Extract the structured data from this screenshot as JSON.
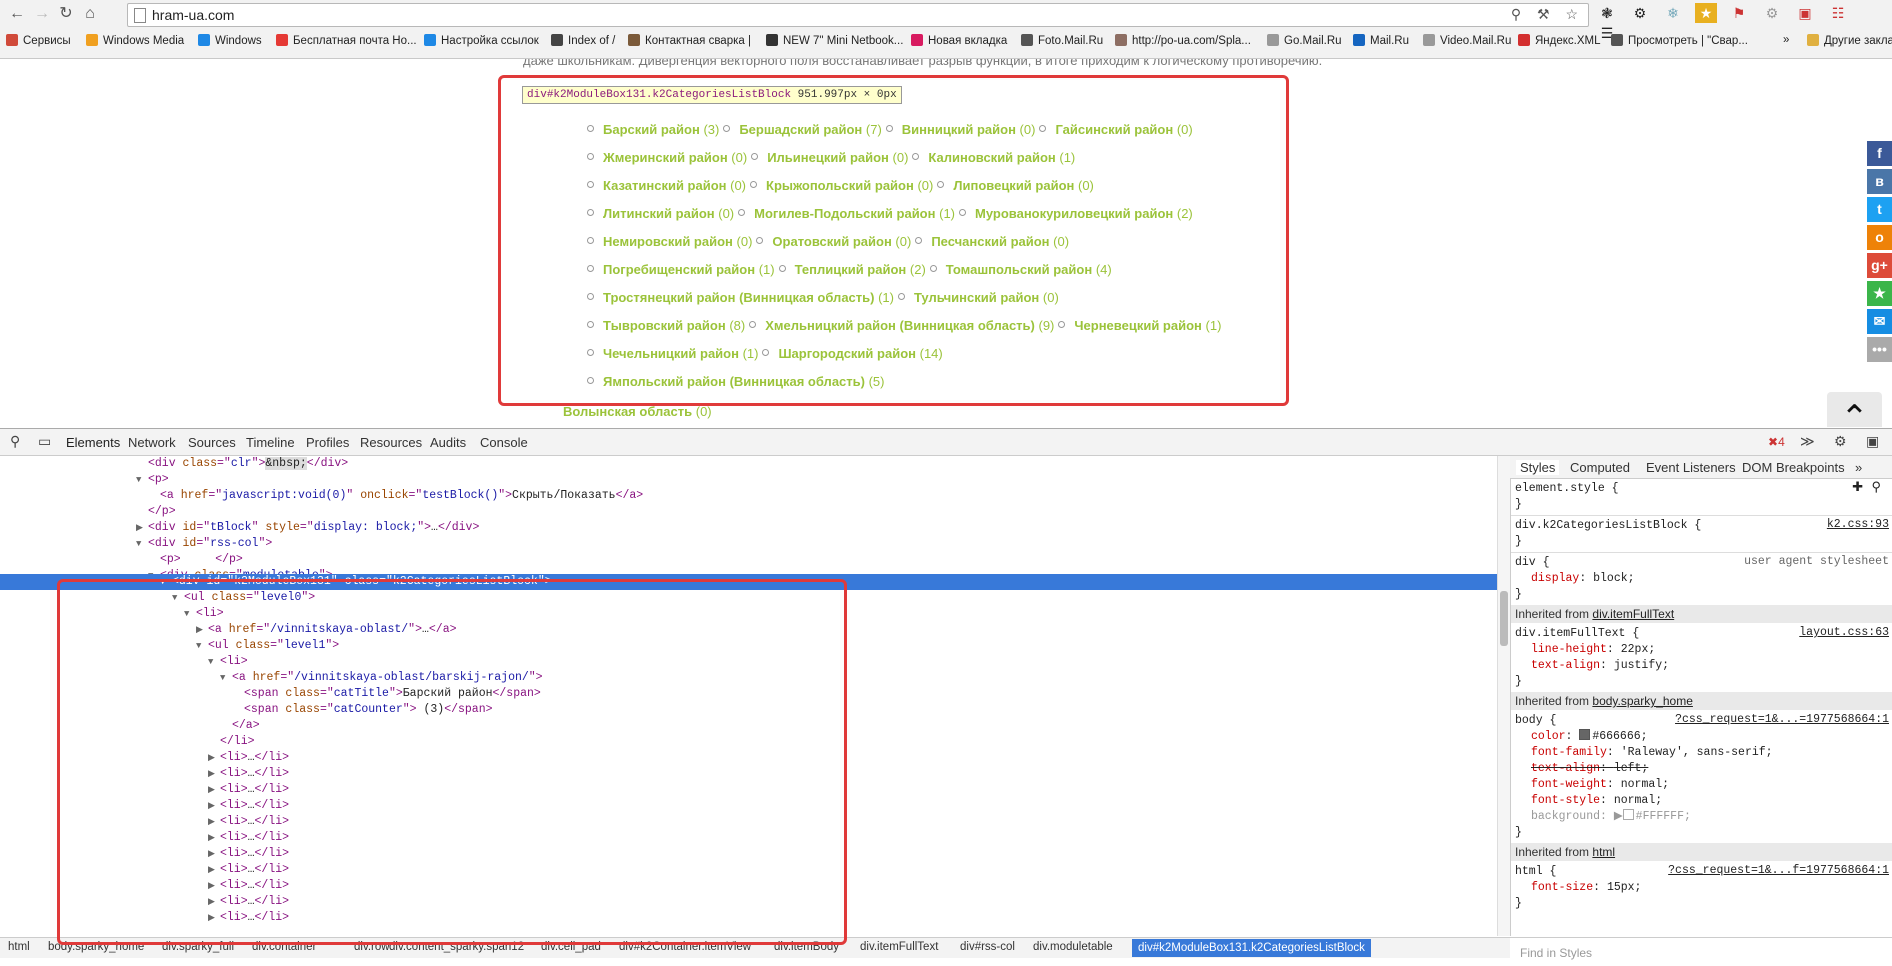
{
  "browser": {
    "url": "hram-ua.com",
    "bookmarks": [
      {
        "label": "Сервисы",
        "color": "#d04a3a"
      },
      {
        "label": "Windows Media",
        "color": "#f0a020"
      },
      {
        "label": "Windows",
        "color": "#1e88e5"
      },
      {
        "label": "Бесплатная почта Но...",
        "color": "#e53935"
      },
      {
        "label": "Настройка ссылок",
        "color": "#1e88e5"
      },
      {
        "label": "Index of /",
        "color": "#444444"
      },
      {
        "label": "Контактная сварка |",
        "color": "#7b5a3a"
      },
      {
        "label": "NEW 7\" Mini Netbook...",
        "color": "#333333"
      },
      {
        "label": "Новая вкладка",
        "color": "#d81b60"
      },
      {
        "label": "Foto.Mail.Ru",
        "color": "#555555"
      },
      {
        "label": "http://po-ua.com/Spla...",
        "color": "#8d6e63"
      },
      {
        "label": "Go.Mail.Ru",
        "color": "#999999"
      },
      {
        "label": "Mail.Ru",
        "color": "#1565c0"
      },
      {
        "label": "Video.Mail.Ru",
        "color": "#999999"
      },
      {
        "label": "Яндекс.XML",
        "color": "#d32f2f"
      },
      {
        "label": "Просмотреть | \"Свар...",
        "color": "#555555"
      },
      {
        "label": "Другие закладки",
        "color": "#e0b040"
      }
    ]
  },
  "page": {
    "top_text": "даже школьникам. Дивергенция векторного поля восстанавливает разрыв функции, в итоге приходим к логическому противоречию.",
    "tooltip": {
      "tag": "div",
      "id_cls": "#k2ModuleBox131.k2CategoriesListBlock",
      "size": "951.997px × 0px"
    },
    "categories": [
      [
        [
          "Барский район",
          "(3)"
        ],
        [
          "Бершадский район",
          "(7)"
        ],
        [
          "Винницкий район",
          "(0)"
        ],
        [
          "Гайсинский район",
          "(0)"
        ]
      ],
      [
        [
          "Жмеринский район",
          "(0)"
        ],
        [
          "Ильинецкий район",
          "(0)"
        ],
        [
          "Калиновский район",
          "(1)"
        ]
      ],
      [
        [
          "Казатинский район",
          "(0)"
        ],
        [
          "Крыжопольский район",
          "(0)"
        ],
        [
          "Липовецкий район",
          "(0)"
        ]
      ],
      [
        [
          "Литинский район",
          "(0)"
        ],
        [
          "Могилев-Подольский район",
          "(1)"
        ],
        [
          "Мурованокуриловецкий район",
          "(2)"
        ]
      ],
      [
        [
          "Немировский район",
          "(0)"
        ],
        [
          "Оратовский район",
          "(0)"
        ],
        [
          "Песчанский район",
          "(0)"
        ]
      ],
      [
        [
          "Погребищенский район",
          "(1)"
        ],
        [
          "Теплицкий район",
          "(2)"
        ],
        [
          "Томашпольский район",
          "(4)"
        ]
      ],
      [
        [
          "Тростянецкий район (Винницкая область)",
          "(1)"
        ],
        [
          "Тульчинский район",
          "(0)"
        ]
      ],
      [
        [
          "Тывровский район",
          "(8)"
        ],
        [
          "Хмельницкий район (Винницкая область)",
          "(9)"
        ],
        [
          "Черневецкий район",
          "(1)"
        ]
      ],
      [
        [
          "Чечельницкий район",
          "(1)"
        ],
        [
          "Шаргородский район",
          "(14)"
        ]
      ],
      [
        [
          "Ямпольский район (Винницкая область)",
          "(5)"
        ]
      ]
    ],
    "oblast": "Волынская область",
    "oblast_count": "(0)",
    "share": [
      {
        "label": "f",
        "color": "#3b5998"
      },
      {
        "label": "в",
        "color": "#4a76a8"
      },
      {
        "label": "t",
        "color": "#1da1f2"
      },
      {
        "label": "о",
        "color": "#ee8208"
      },
      {
        "label": "g+",
        "color": "#dd4b39"
      },
      {
        "label": "★",
        "color": "#3bb54a"
      },
      {
        "label": "✉",
        "color": "#168de2"
      },
      {
        "label": "•••",
        "color": "#aaaaaa"
      }
    ]
  },
  "devtools": {
    "tabs": [
      "Elements",
      "Network",
      "Sources",
      "Timeline",
      "Profiles",
      "Resources",
      "Audits",
      "Console"
    ],
    "error_count": "4",
    "style_tabs": [
      "Styles",
      "Computed",
      "Event Listeners",
      "DOM Breakpoints",
      "»"
    ],
    "crumbs": [
      "html",
      "body.sparky_home",
      "div.sparky_full",
      "div.container",
      "div.row",
      "div.content_sparky.span12",
      "div.cell_pad",
      "div#k2Container.itemView",
      "div.itemBody",
      "div.itemFullText",
      "div#rss-col",
      "div.moduletable",
      "div#k2ModuleBox131.k2CategoriesListBlock"
    ],
    "find_placeholder": "Find in Styles",
    "styles": {
      "element_style": "element.style {",
      "rule1": "div.k2CategoriesListBlock {",
      "rule1_src": "k2.css:93",
      "rule2": "div {",
      "rule2_src": "user agent stylesheet",
      "rule2_prop": "display",
      "rule2_val": "block;",
      "inh1": "Inherited from",
      "inh1_link": "div.itemFullText",
      "rule3": "div.itemFullText {",
      "rule3_src": "layout.css:63",
      "rule3_p1": "line-height",
      "rule3_v1": "22px;",
      "rule3_p2": "text-align",
      "rule3_v2": "justify;",
      "inh2_link": "body.sparky_home",
      "rule4": "body {",
      "rule4_src": "?css_request=1&...=1977568664:1",
      "rule4_p1": "color",
      "rule4_v1": "#666666;",
      "rule4_p2": "font-family",
      "rule4_v2": "'Raleway', sans-serif;",
      "rule4_p3": "text-align",
      "rule4_v3": "left;",
      "rule4_p4": "font-weight",
      "rule4_v4": "normal;",
      "rule4_p5": "font-style",
      "rule4_v5": "normal;",
      "rule4_p6": "background",
      "rule4_v6": "#FFFFFF;",
      "inh3_link": "html",
      "rule5": "html {",
      "rule5_src": "?css_request=1&...f=1977568664:1",
      "rule5_p1": "font-size",
      "rule5_v1": "15px;",
      "close": "}"
    }
  }
}
